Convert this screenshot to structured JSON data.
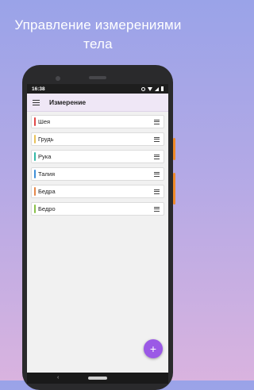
{
  "headline": {
    "line1": "Управление измерениями",
    "line2": "тела"
  },
  "status": {
    "time": "16:38"
  },
  "appbar": {
    "title": "Измерение",
    "menu_icon": "hamburger-menu-icon"
  },
  "items": [
    {
      "label": "Шея",
      "color": "#e04848"
    },
    {
      "label": "Грудь",
      "color": "#e8c25a"
    },
    {
      "label": "Рука",
      "color": "#33b8a6"
    },
    {
      "label": "Талия",
      "color": "#3f8fd8"
    },
    {
      "label": "Бедра",
      "color": "#e5874a"
    },
    {
      "label": "Бедро",
      "color": "#8ac14a"
    }
  ],
  "fab": {
    "label": "+",
    "icon": "plus-icon",
    "color": "#9b59e6"
  },
  "nav": {
    "back": "‹"
  }
}
